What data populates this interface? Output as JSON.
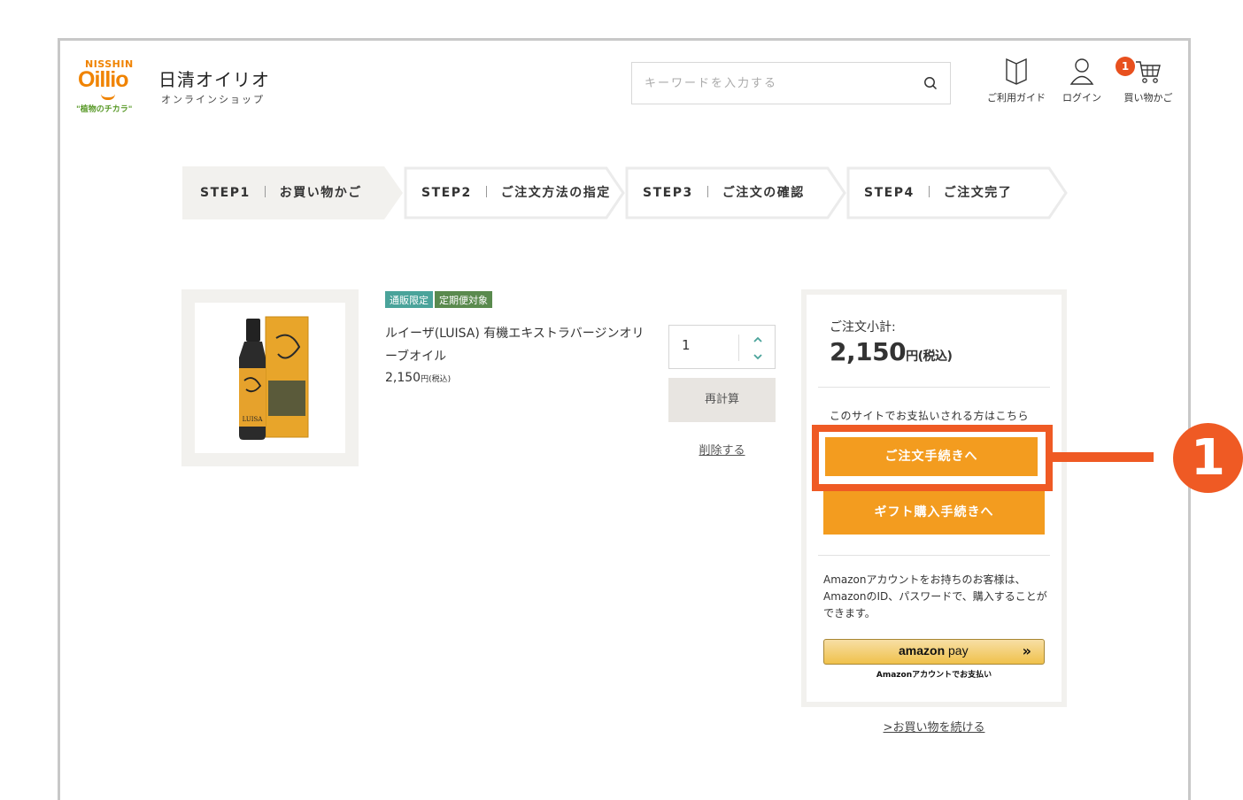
{
  "header": {
    "logo": {
      "top": "NISSHIN",
      "main": "Oillio",
      "tagline": "\"植物のチカラ\""
    },
    "brand_title": "日清オイリオ",
    "brand_sub": "オンラインショップ",
    "search_placeholder": "キーワードを入力する",
    "nav": {
      "guide": "ご利用ガイド",
      "login": "ログイン",
      "cart": "買い物かご"
    },
    "cart_count": "1"
  },
  "steps": [
    {
      "num": "STEP1",
      "label": "お買い物かご",
      "active": true
    },
    {
      "num": "STEP2",
      "label": "ご注文方法の指定",
      "active": false
    },
    {
      "num": "STEP3",
      "label": "ご注文の確認",
      "active": false
    },
    {
      "num": "STEP4",
      "label": "ご注文完了",
      "active": false
    }
  ],
  "product": {
    "badges": [
      "通販限定",
      "定期便対象"
    ],
    "name": "ルイーザ(LUISA) 有機エキストラバージンオリーブオイル",
    "price": "2,150",
    "price_unit": "円(税込)",
    "quantity": "1",
    "recalc_label": "再計算",
    "delete_label": "削除する",
    "package_label": "LUISA"
  },
  "summary": {
    "label": "ご注文小計:",
    "amount": "2,150",
    "yen": "円",
    "tax": "(税込)",
    "pay_note": "このサイトでお支払いされる方はこちら",
    "order_button": "ご注文手続きへ",
    "gift_button": "ギフト購入手続きへ",
    "amazon_note": "Amazonアカウントをお持ちのお客様は、AmazonのID、パスワードで、購入することができます。",
    "amazon_logo": "amazon",
    "amazon_pay": "pay",
    "amazon_arrows": "»",
    "amazon_sub": "Amazonアカウントでお支払い"
  },
  "continue_link": ">お買い物を続ける",
  "annotation": {
    "number": "1",
    "color": "#ef5a24"
  },
  "colors": {
    "accent": "#f39c1f",
    "annotation": "#ef5a24",
    "badge_teal": "#4aa39a",
    "badge_green": "#5a8a4e"
  }
}
